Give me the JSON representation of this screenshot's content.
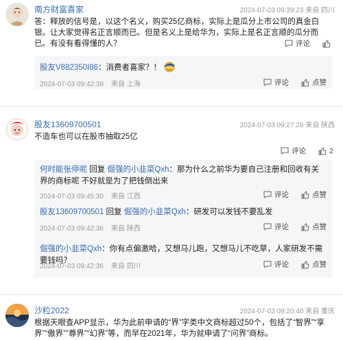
{
  "post1": {
    "username": "南方财富喜家",
    "time": "2024-07-03 09:39:23",
    "location": "来自 四川",
    "text": "答：释放的信号是，以这个名义，购买25亿商标，实际上是瓜分上市公司的真金白银。让大家觉得名正言顺而已。但是名义上是给华为，实际上是名正言顺的瓜分而已。有没有看得懂的人？",
    "comment_label": "评论",
    "like_label": "",
    "reply": {
      "user": "股友V882350I86",
      "text": "：消费者喜家？！",
      "time": "2024-07-03 09:42:39",
      "location": "来自 上海",
      "comment_label": "评论",
      "like_label": "点赞"
    }
  },
  "post2": {
    "username": "股友13609700501",
    "time": "2024-07-03 09:27:28",
    "location": "来自 陕西",
    "text": "不造车也可以在股市抽取25亿",
    "comment_label": "评论",
    "like_count": "2",
    "replies": [
      {
        "user": "何时能张停呢",
        "mid": " 回复 ",
        "target": "倔强的小韭菜Qxh",
        "text": "：那为什么之前华为要自己注册和回收有关界的商标呢 不好就是为了把钱倒出来",
        "time": "2024-07-03 09:45:30",
        "location": "来自 江西",
        "comment_label": "评论",
        "like_label": "点赞"
      },
      {
        "user": "股友13609700501",
        "mid": " 回复 ",
        "target": "倔强的小韭菜Qxh",
        "text": "：研发可以发钱不要乱发",
        "time": "2024-07-03 09:42:36",
        "location": "来自 陕西",
        "comment_label": "评论",
        "like_label": "点赞"
      },
      {
        "user": "倔强的小韭菜Qxh",
        "mid": "",
        "target": "",
        "text": "：你有点偏激哈，又想马儿跑，又想马儿不吃草，人家研发不需要钱吗？",
        "time": "2024-07-03 09:42:36",
        "location": "来自 四川",
        "comment_label": "评论",
        "like_label": "点赞"
      }
    ]
  },
  "post3": {
    "username": "沙粒2022",
    "time": "2024-07-03 09:20:40",
    "location": "来自 重庆",
    "text": "根据天眼查APP显示，华为此前申请的“界”字类中文商标超过50个，包括了“智界”“享界”“傲界”“尊界”“幻界”等，而早在2021年，华为就申请了“问界”商标。"
  },
  "colors": {
    "link": "#3b6bb0",
    "meta": "#999999",
    "reply_bg": "#f5f6f8"
  }
}
